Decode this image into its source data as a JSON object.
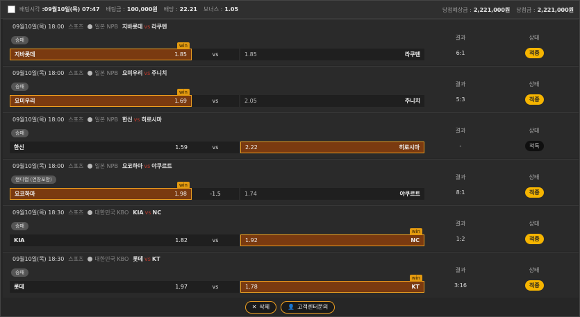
{
  "header": {
    "bet_time_label": "배팅시각",
    "bet_time": ":09월10일(목) 07:47",
    "bet_amount_label": "배팅금 :",
    "bet_amount": "100,000원",
    "odds_label": "배당 :",
    "odds": "22.21",
    "bonus_label": "보너스 :",
    "bonus": "1.05",
    "expected_label": "당첨예상금 :",
    "expected": "2,221,000원",
    "won_label": "당첨금 :",
    "won": "2,221,000원"
  },
  "labels": {
    "result": "결과",
    "status": "상태",
    "vs": "vs",
    "win": "win",
    "sport": "스포츠"
  },
  "games": [
    {
      "datetime": "09월10일(목) 18:00",
      "league": "일본 NPB",
      "home": "지바롯데",
      "away": "라쿠텐",
      "market": "승패",
      "home_odds": "1.85",
      "mid": "vs",
      "away_odds": "1.85",
      "pick": "home",
      "score": "6:1",
      "status": "적중",
      "status_type": "hit"
    },
    {
      "datetime": "09월10일(목) 18:00",
      "league": "일본 NPB",
      "home": "요미우리",
      "away": "주니치",
      "market": "승패",
      "home_odds": "1.69",
      "mid": "vs",
      "away_odds": "2.05",
      "pick": "home",
      "score": "5:3",
      "status": "적중",
      "status_type": "hit"
    },
    {
      "datetime": "09월10일(목) 18:00",
      "league": "일본 NPB",
      "home": "한신",
      "away": "히로시마",
      "market": "승패",
      "home_odds": "1.59",
      "mid": "vs",
      "away_odds": "2.22",
      "pick": "away_nowin",
      "score": "-",
      "status": "적특",
      "status_type": "miss"
    },
    {
      "datetime": "09월10일(목) 18:00",
      "league": "일본 NPB",
      "home": "요코하마",
      "away": "야쿠르트",
      "market": "핸디캡 (연장포함)",
      "home_odds": "1.98",
      "mid": "-1.5",
      "away_odds": "1.74",
      "pick": "home",
      "score": "8:1",
      "status": "적중",
      "status_type": "hit"
    },
    {
      "datetime": "09월10일(목) 18:30",
      "league": "대한민국 KBO",
      "home": "KIA",
      "away": "NC",
      "market": "승패",
      "home_odds": "1.82",
      "mid": "vs",
      "away_odds": "1.92",
      "pick": "away",
      "score": "1:2",
      "status": "적중",
      "status_type": "hit"
    },
    {
      "datetime": "09월10일(목) 18:30",
      "league": "대한민국 KBO",
      "home": "롯데",
      "away": "KT",
      "market": "승패",
      "home_odds": "1.97",
      "mid": "vs",
      "away_odds": "1.78",
      "pick": "away",
      "score": "3:16",
      "status": "적중",
      "status_type": "hit"
    }
  ],
  "footer": {
    "delete_label": "삭제",
    "support_label": "고객센터문의"
  }
}
